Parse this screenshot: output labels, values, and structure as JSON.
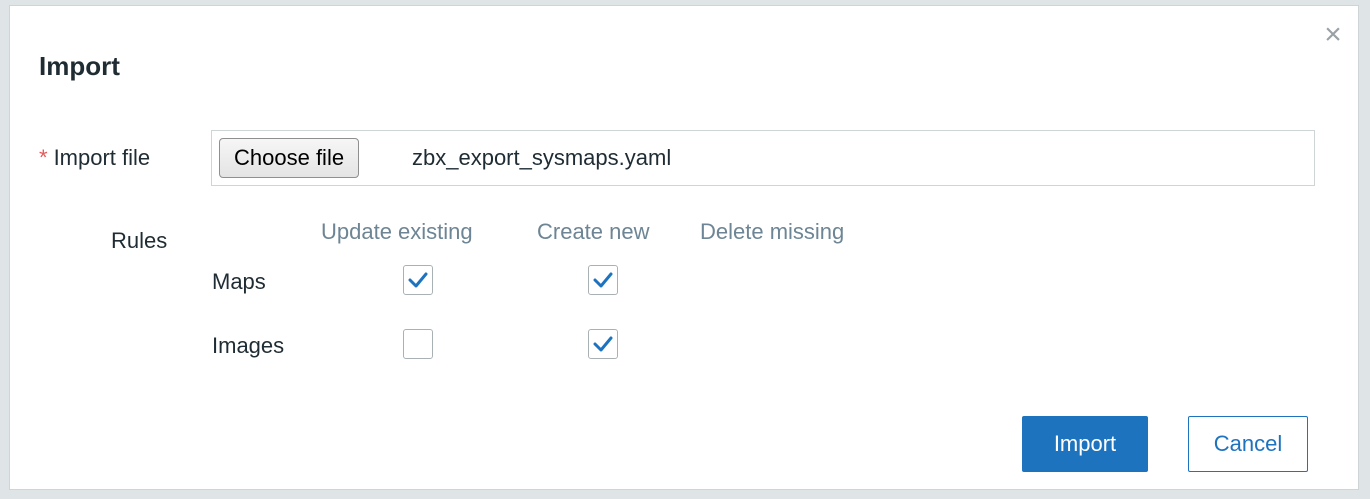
{
  "dialog": {
    "title": "Import",
    "close_icon": "close-icon",
    "close_glyph": "×"
  },
  "import_file": {
    "required_mark": "*",
    "label": "Import file",
    "button_label": "Choose file",
    "file_name": "zbx_export_sysmaps.yaml"
  },
  "rules": {
    "label": "Rules",
    "columns": [
      "Update existing",
      "Create new",
      "Delete missing"
    ],
    "rows": [
      {
        "label": "Maps",
        "update_existing": true,
        "create_new": true
      },
      {
        "label": "Images",
        "update_existing": false,
        "create_new": true
      }
    ]
  },
  "buttons": {
    "import": "Import",
    "cancel": "Cancel"
  },
  "colors": {
    "accent": "#1e73be",
    "column_header": "#6d8594",
    "required": "#e45959"
  }
}
